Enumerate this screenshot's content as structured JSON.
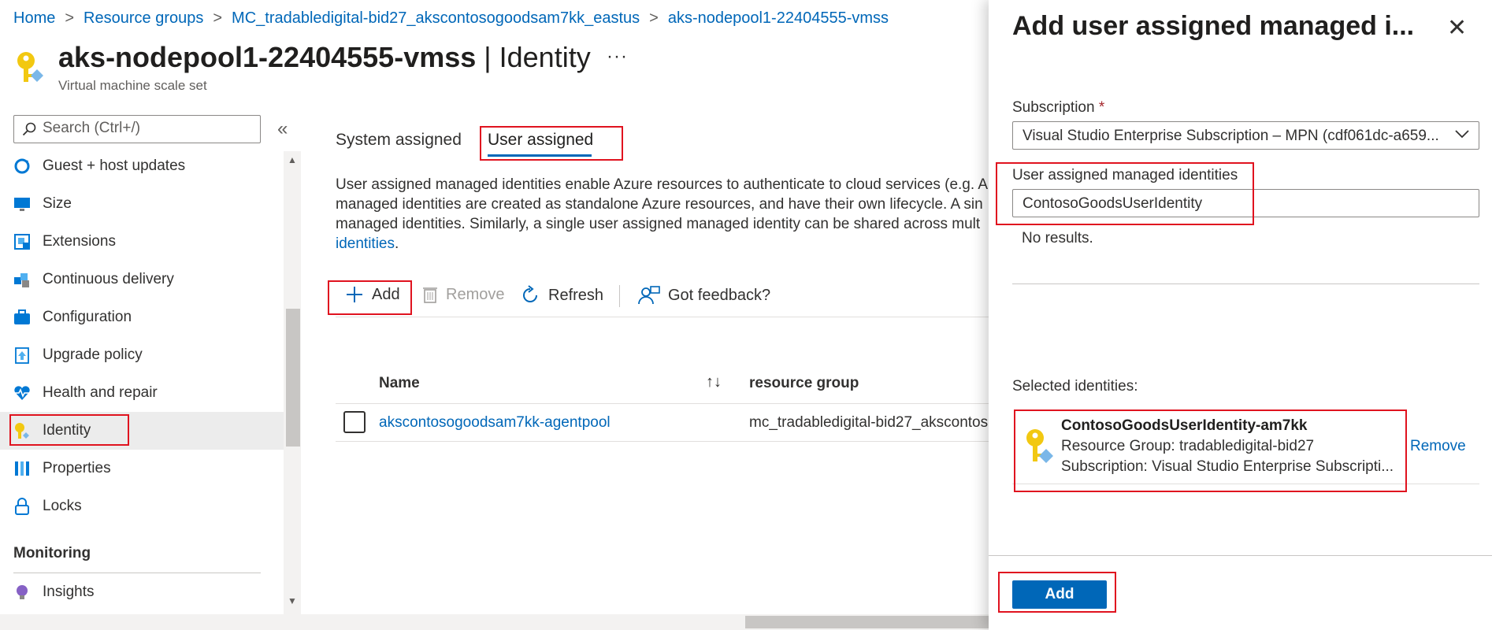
{
  "breadcrumb": [
    "Home",
    "Resource groups",
    "MC_tradabledigital-bid27_akscontosogoodsam7kk_eastus",
    "aks-nodepool1-22404555-vmss"
  ],
  "header": {
    "title": "aks-nodepool1-22404555-vmss",
    "title_suffix": " | Identity",
    "more": "···",
    "subtitle": "Virtual machine scale set"
  },
  "sidebar": {
    "search_placeholder": "Search (Ctrl+/)",
    "collapse": "«",
    "items": [
      {
        "label": "Guest + host updates",
        "icon": "refresh-gear-icon"
      },
      {
        "label": "Size",
        "icon": "monitor-icon"
      },
      {
        "label": "Extensions",
        "icon": "extension-icon"
      },
      {
        "label": "Continuous delivery",
        "icon": "cubes-icon"
      },
      {
        "label": "Configuration",
        "icon": "briefcase-icon"
      },
      {
        "label": "Upgrade policy",
        "icon": "upgrade-icon"
      },
      {
        "label": "Health and repair",
        "icon": "heart-pulse-icon"
      },
      {
        "label": "Identity",
        "icon": "key-icon"
      },
      {
        "label": "Properties",
        "icon": "properties-icon"
      },
      {
        "label": "Locks",
        "icon": "lock-icon"
      }
    ],
    "group_monitoring": "Monitoring",
    "insights": "Insights"
  },
  "main": {
    "tabs": [
      "System assigned",
      "User assigned"
    ],
    "description": [
      "User assigned managed identities enable Azure resources to authenticate to cloud services (e.g. A",
      "managed identities are created as standalone Azure resources, and have their own lifecycle. A sin",
      "managed identities. Similarly, a single user assigned managed identity can be shared across mult"
    ],
    "description_link": "identities",
    "toolbar": {
      "add": "Add",
      "remove": "Remove",
      "refresh": "Refresh",
      "feedback": "Got feedback?"
    },
    "table": {
      "headers": [
        "Name",
        "resource group"
      ],
      "rows": [
        {
          "name": "akscontosogoodsam7kk-agentpool",
          "resource_group": "mc_tradabledigital-bid27_akscontos"
        }
      ]
    }
  },
  "panel": {
    "title": "Add user assigned managed i...",
    "close": "✕",
    "subscription_label": "Subscription",
    "required_mark": "*",
    "subscription_value": "Visual Studio Enterprise Subscription – MPN (cdf061dc-a659...",
    "identities_label": "User assigned managed identities",
    "identities_value": "ContosoGoodsUserIdentity",
    "no_results": "No results.",
    "selected_label": "Selected identities:",
    "selected": {
      "name": "ContosoGoodsUserIdentity-am7kk",
      "resource_group": "Resource Group: tradabledigital-bid27",
      "subscription": "Subscription: Visual Studio Enterprise Subscripti...",
      "remove": "Remove"
    },
    "add_button": "Add"
  },
  "colors": {
    "accent": "#0067b8",
    "highlight_box": "#e0131f"
  }
}
